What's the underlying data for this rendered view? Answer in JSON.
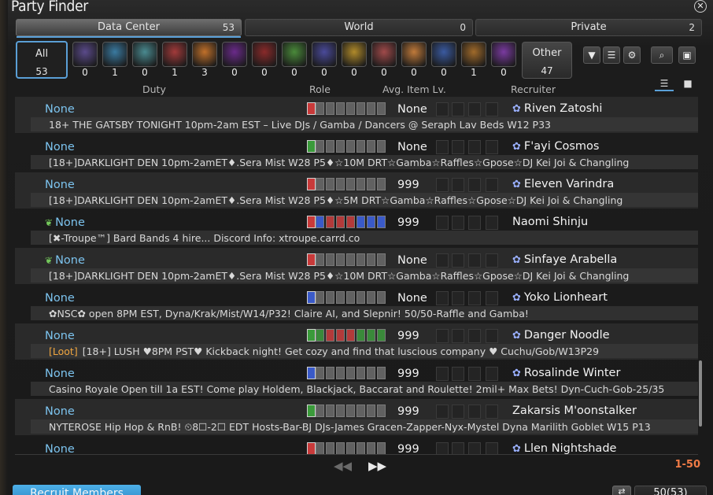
{
  "window": {
    "title": "Party Finder"
  },
  "tabs": [
    {
      "label": "Data Center",
      "count": "53"
    },
    {
      "label": "World",
      "count": "0"
    },
    {
      "label": "Private",
      "count": "2"
    }
  ],
  "categories": {
    "all": {
      "label": "All",
      "count": "53"
    },
    "items": [
      {
        "icon": "question-icon",
        "color": "#5a4a8a",
        "count": "0"
      },
      {
        "icon": "arch-icon",
        "color": "#3a7aa0",
        "count": "1"
      },
      {
        "icon": "scroll-icon",
        "color": "#4a8a90",
        "count": "0"
      },
      {
        "icon": "raid-icon",
        "color": "#a23a3a",
        "count": "1"
      },
      {
        "icon": "horseshoe-icon",
        "color": "#c0702a",
        "count": "3"
      },
      {
        "icon": "demon-icon",
        "color": "#6a2a8a",
        "count": "0"
      },
      {
        "icon": "crossed-swords-icon",
        "color": "#8a2a2a",
        "count": "0"
      },
      {
        "icon": "leaf-icon",
        "color": "#4a8a3a",
        "count": "0"
      },
      {
        "icon": "treasure-map-icon",
        "color": "#4a4a9a",
        "count": "0"
      },
      {
        "icon": "chest-icon",
        "color": "#b08a2a",
        "count": "0"
      },
      {
        "icon": "gold-saucer-icon",
        "color": "#a04a4a",
        "count": "0"
      },
      {
        "icon": "feather-icon",
        "color": "#c07a3a",
        "count": "0"
      },
      {
        "icon": "trident-icon",
        "color": "#3a5aa0",
        "count": "0"
      },
      {
        "icon": "star-burst-icon",
        "color": "#a06a2a",
        "count": "1"
      },
      {
        "icon": "cosmic-icon",
        "color": "#7a3aa0",
        "count": "0"
      }
    ],
    "other": {
      "label": "Other",
      "count": "47"
    }
  },
  "headers": {
    "duty": "Duty",
    "role": "Role",
    "ilvl": "Avg. Item Lv.",
    "recruiter": "Recruiter"
  },
  "listings": [
    {
      "duty": "None",
      "ilvl": "None",
      "recruiter": "Riven Zatoshi",
      "flower": true,
      "sprout": false,
      "check": "#c83a3a",
      "roles": "gggggggg",
      "desc": "18+ THE GATSBY  TONIGHT 10pm-2am EST – Live DJs / Gamba / Dancers @ Seraph Lav Beds W12 P33",
      "loot": ""
    },
    {
      "duty": "None",
      "ilvl": "None",
      "recruiter": "F'ayi Cosmos",
      "flower": true,
      "sprout": false,
      "check": "#3a9a3a",
      "roles": "gggggggg",
      "desc": "[18+]DARKLIGHT DEN 10pm-2amET♦.Sera Mist W28 P5♦☆10M DRT☆Gamba☆Raffles☆Gpose☆DJ Kei Joi & Changling",
      "loot": ""
    },
    {
      "duty": "None",
      "ilvl": "999",
      "recruiter": "Eleven Varindra",
      "flower": true,
      "sprout": false,
      "check": "#c83a3a",
      "roles": "gggggggg",
      "desc": "[18+]DARKLIGHT DEN 10pm-2amET♦.Sera Mist W28 P5♦☆5M DRT☆Gamba☆Raffles☆Gpose☆DJ Kei Joi & Changling",
      "loot": ""
    },
    {
      "duty": "None",
      "ilvl": "999",
      "recruiter": "Naomi Shinju",
      "flower": false,
      "sprout": true,
      "check": "#c83a3a",
      "roles": "bbrrrbbb",
      "desc": "[✖-Troupe™]  Bard Bands 4 hire...       Discord Info:  xtroupe.carrd.co",
      "loot": ""
    },
    {
      "duty": "None",
      "ilvl": "None",
      "recruiter": "Sinfaye Arabella",
      "flower": true,
      "sprout": true,
      "check": "#c83a3a",
      "roles": "gggggggg",
      "desc": "[18+]DARKLIGHT DEN 10pm-2amET♦.Sera Mist W28 P5♦☆10M DRT☆Gamba☆Raffles☆Gpose☆DJ Kei Joi & Changling",
      "loot": ""
    },
    {
      "duty": "None",
      "ilvl": "None",
      "recruiter": "Yoko Lionheart",
      "flower": true,
      "sprout": false,
      "check": "#3a5ac8",
      "roles": "gggggggg",
      "desc": "✿NSC✿ open 8PM EST, Dyna/Krak/Mist/W14/P32! Claire AI, and Slepnir! 50/50-Raffle and Gamba!",
      "loot": ""
    },
    {
      "duty": "None",
      "ilvl": "999",
      "recruiter": "Danger Noodle",
      "flower": true,
      "sprout": false,
      "check": "#3a9a3a",
      "roles": "ggrrrggg",
      "desc": "[18+] LUSH ♥8PM PST♥ Kickback night! Get cozy and find that luscious company ♥ Cuchu/Gob/W13P29",
      "loot": "[Loot]"
    },
    {
      "duty": "None",
      "ilvl": "999",
      "recruiter": "Rosalinde Winter",
      "flower": true,
      "sprout": false,
      "check": "#3a5ac8",
      "roles": "gggggggg",
      "desc": "Casino Royale Open till 1a EST! Come play Holdem, Blackjack, Baccarat and Roulette! 2mil+ Max Bets! Dyn-Cuch-Gob-25/35",
      "loot": ""
    },
    {
      "duty": "None",
      "ilvl": "999",
      "recruiter": "Zakarsis M'oonstalker",
      "flower": false,
      "sprout": false,
      "check": "#3a9a3a",
      "roles": "gggggggg",
      "desc": "NYTEROSE Hip Hop & RnB! ⏲8☐-2☐ EDT Hosts-Bar-BJ DJs-James Gracen-Zapper-Nyx-Mystel Dyna Marilith Goblet W15 P13",
      "loot": ""
    },
    {
      "duty": "None",
      "ilvl": "999",
      "recruiter": "Llen Nightshade",
      "flower": true,
      "sprout": false,
      "check": "#c83a3a",
      "roles": "gggggggg",
      "desc": "",
      "loot": ""
    }
  ],
  "footer": {
    "prev": "◀◀",
    "next": "▶▶",
    "page_range": "1-50",
    "recruit_label": "Recruit Members",
    "count_label": "50(53)",
    "refresh_icon": "⇄"
  },
  "colors": {
    "accent": "#5aa0d8",
    "duty": "#7cc3ee",
    "page_range": "#f07b46",
    "loot": "#f0a640"
  }
}
